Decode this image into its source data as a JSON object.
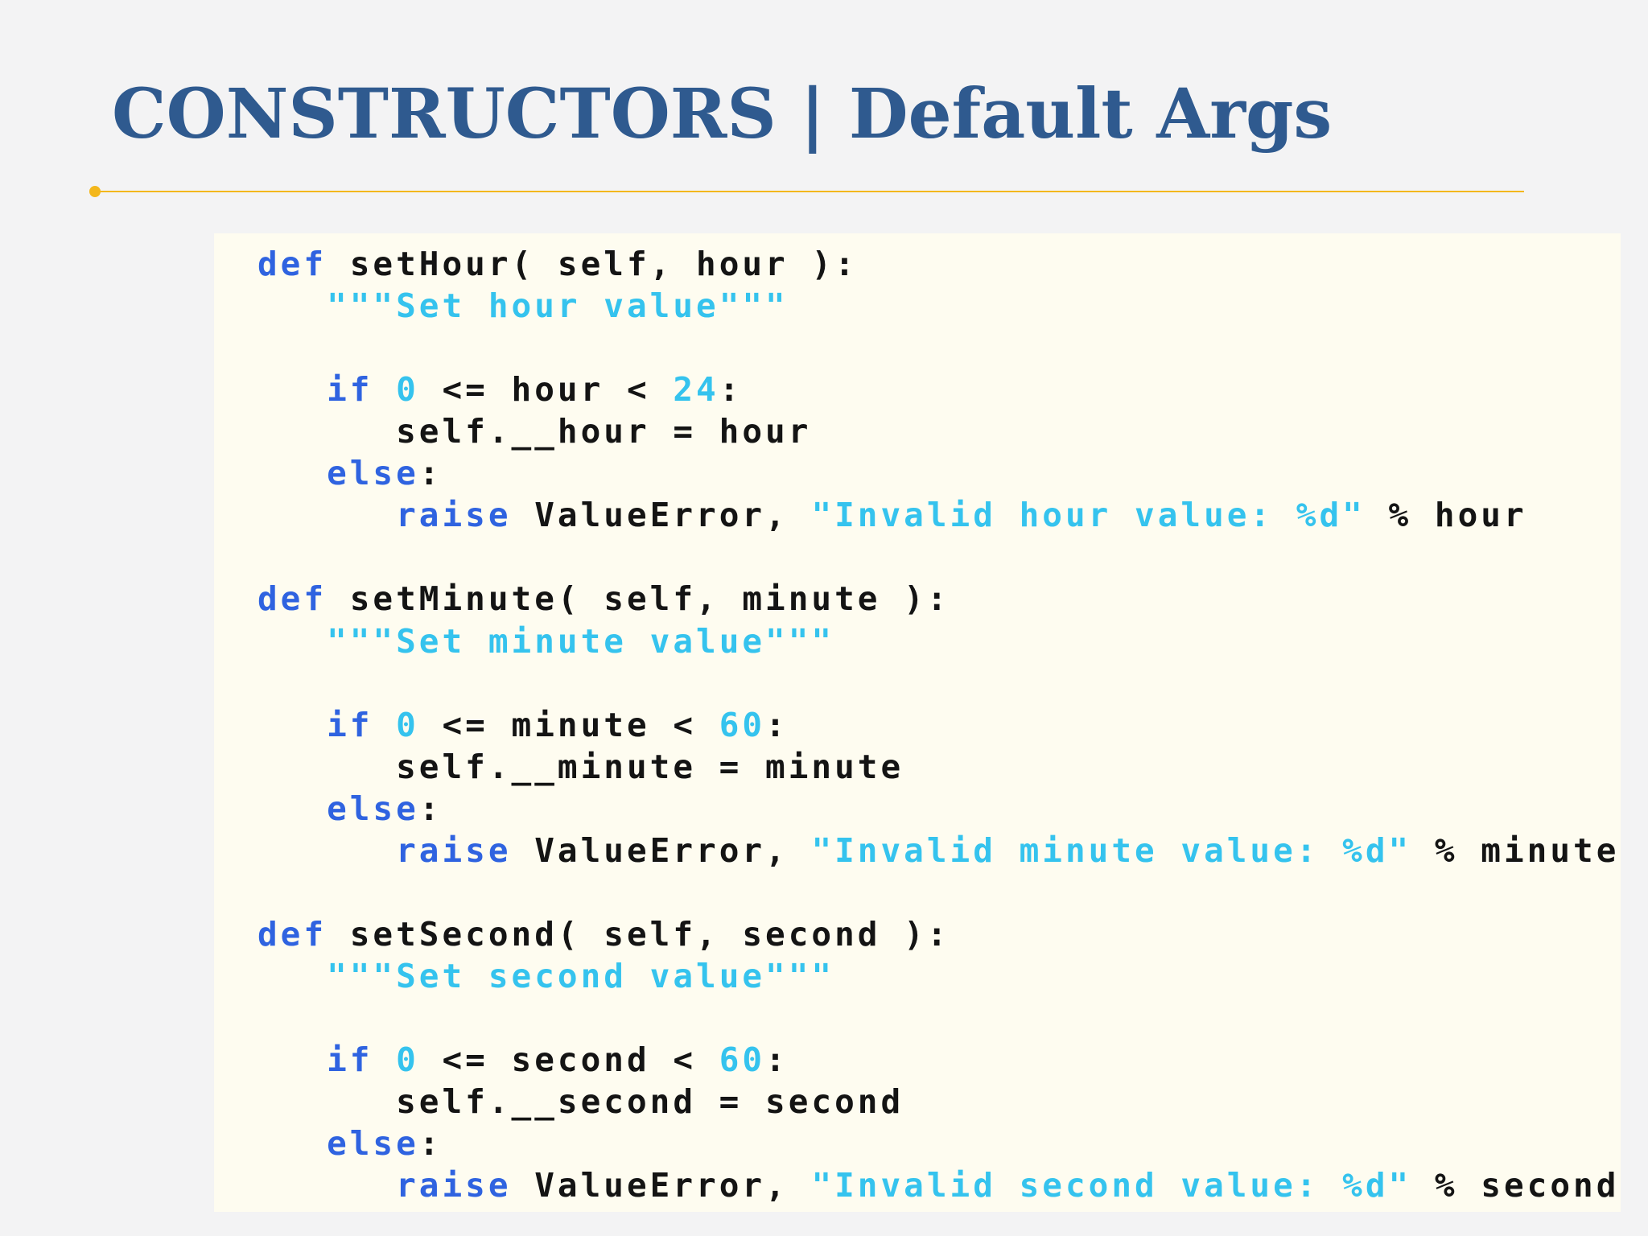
{
  "slide": {
    "title": "CONSTRUCTORS | Default Args"
  },
  "colors": {
    "title": "#2f5a8f",
    "accent_rule": "#f3b71c",
    "code_background": "#fefcf0",
    "keyword": "#2f63e0",
    "string_and_number": "#35c3ee",
    "plain_code": "#141414"
  },
  "code": {
    "language": "python",
    "lines": [
      [
        {
          "t": "def",
          "k": "kw"
        },
        {
          "t": " setHour( self, hour ):",
          "k": "plain"
        }
      ],
      [
        {
          "t": "   ",
          "k": "plain"
        },
        {
          "t": "\"\"\"Set hour value\"\"\"",
          "k": "str"
        }
      ],
      [],
      [
        {
          "t": "   ",
          "k": "plain"
        },
        {
          "t": "if",
          "k": "kw"
        },
        {
          "t": " ",
          "k": "plain"
        },
        {
          "t": "0",
          "k": "num"
        },
        {
          "t": " <= hour < ",
          "k": "plain"
        },
        {
          "t": "24",
          "k": "num"
        },
        {
          "t": ":",
          "k": "plain"
        }
      ],
      [
        {
          "t": "      self.__hour = hour",
          "k": "plain"
        }
      ],
      [
        {
          "t": "   ",
          "k": "plain"
        },
        {
          "t": "else",
          "k": "kw"
        },
        {
          "t": ":",
          "k": "plain"
        }
      ],
      [
        {
          "t": "      ",
          "k": "plain"
        },
        {
          "t": "raise",
          "k": "kw"
        },
        {
          "t": " ValueError, ",
          "k": "plain"
        },
        {
          "t": "\"Invalid hour value: %d\"",
          "k": "str"
        },
        {
          "t": " % hour",
          "k": "plain"
        }
      ],
      [],
      [
        {
          "t": "def",
          "k": "kw"
        },
        {
          "t": " setMinute( self, minute ):",
          "k": "plain"
        }
      ],
      [
        {
          "t": "   ",
          "k": "plain"
        },
        {
          "t": "\"\"\"Set minute value\"\"\"",
          "k": "str"
        }
      ],
      [],
      [
        {
          "t": "   ",
          "k": "plain"
        },
        {
          "t": "if",
          "k": "kw"
        },
        {
          "t": " ",
          "k": "plain"
        },
        {
          "t": "0",
          "k": "num"
        },
        {
          "t": " <= minute < ",
          "k": "plain"
        },
        {
          "t": "60",
          "k": "num"
        },
        {
          "t": ":",
          "k": "plain"
        }
      ],
      [
        {
          "t": "      self.__minute = minute",
          "k": "plain"
        }
      ],
      [
        {
          "t": "   ",
          "k": "plain"
        },
        {
          "t": "else",
          "k": "kw"
        },
        {
          "t": ":",
          "k": "plain"
        }
      ],
      [
        {
          "t": "      ",
          "k": "plain"
        },
        {
          "t": "raise",
          "k": "kw"
        },
        {
          "t": " ValueError, ",
          "k": "plain"
        },
        {
          "t": "\"Invalid minute value: %d\"",
          "k": "str"
        },
        {
          "t": " % minute",
          "k": "plain"
        }
      ],
      [],
      [
        {
          "t": "def",
          "k": "kw"
        },
        {
          "t": " setSecond( self, second ):",
          "k": "plain"
        }
      ],
      [
        {
          "t": "   ",
          "k": "plain"
        },
        {
          "t": "\"\"\"Set second value\"\"\"",
          "k": "str"
        }
      ],
      [],
      [
        {
          "t": "   ",
          "k": "plain"
        },
        {
          "t": "if",
          "k": "kw"
        },
        {
          "t": " ",
          "k": "plain"
        },
        {
          "t": "0",
          "k": "num"
        },
        {
          "t": " <= second < ",
          "k": "plain"
        },
        {
          "t": "60",
          "k": "num"
        },
        {
          "t": ":",
          "k": "plain"
        }
      ],
      [
        {
          "t": "      self.__second = second",
          "k": "plain"
        }
      ],
      [
        {
          "t": "   ",
          "k": "plain"
        },
        {
          "t": "else",
          "k": "kw"
        },
        {
          "t": ":",
          "k": "plain"
        }
      ],
      [
        {
          "t": "      ",
          "k": "plain"
        },
        {
          "t": "raise",
          "k": "kw"
        },
        {
          "t": " ValueError, ",
          "k": "plain"
        },
        {
          "t": "\"Invalid second value: %d\"",
          "k": "str"
        },
        {
          "t": " % second",
          "k": "plain"
        }
      ]
    ]
  }
}
